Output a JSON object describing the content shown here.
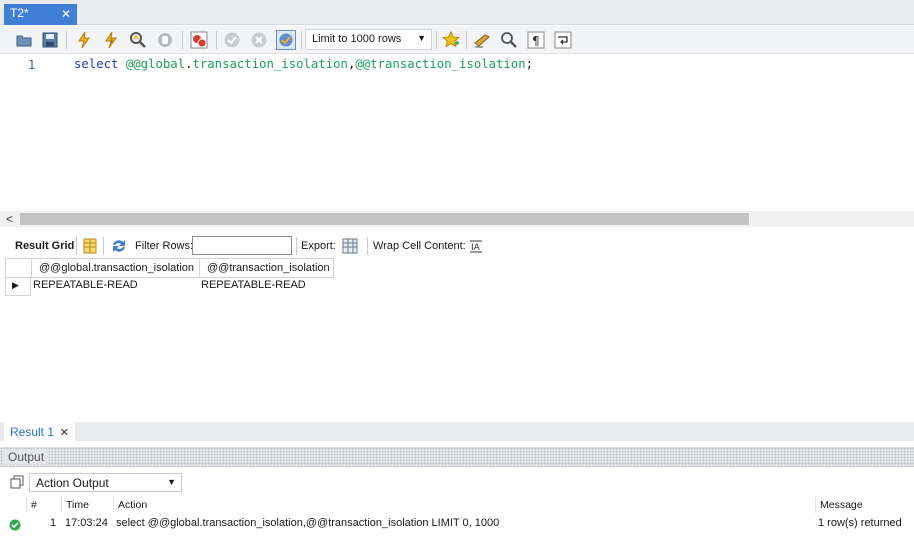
{
  "editor_tab": {
    "title": "T2*",
    "close_glyph": "✕"
  },
  "toolbar": {
    "buttons": [
      {
        "name": "open-file-icon"
      },
      {
        "name": "save-icon"
      },
      {
        "name": "execute-icon"
      },
      {
        "name": "execute-current-icon"
      },
      {
        "name": "explain-icon"
      },
      {
        "name": "stop-icon"
      },
      {
        "name": "toggle-error-stop-icon"
      },
      {
        "name": "commit-icon"
      },
      {
        "name": "rollback-icon"
      },
      {
        "name": "autocommit-icon"
      },
      {
        "name": "bookmark-icon"
      },
      {
        "name": "beautify-icon"
      },
      {
        "name": "find-icon"
      },
      {
        "name": "invisible-chars-icon"
      },
      {
        "name": "wrap-icon"
      }
    ],
    "limit_label": "Limit to 1000 rows"
  },
  "editor": {
    "line_number": "1",
    "tokens": {
      "select": "select",
      "global_prefix": "@@global",
      "dot": ".",
      "tx1": "transaction_isolation",
      "comma": ",",
      "session_prefix": "@@",
      "tx2": "transaction_isolation",
      "semicolon": ";"
    }
  },
  "result_toolbar": {
    "result_grid_label": "Result Grid",
    "filter_rows_label": "Filter Rows:",
    "filter_value": "",
    "export_label": "Export:",
    "wrap_label": "Wrap Cell Content:"
  },
  "grid": {
    "columns": [
      "@@global.transaction_isolation",
      "@@transaction_isolation"
    ],
    "rows": [
      [
        "REPEATABLE-READ",
        "REPEATABLE-READ"
      ]
    ]
  },
  "result_tab": {
    "label": "Result 1",
    "close_glyph": "✕"
  },
  "output": {
    "title": "Output",
    "selector_value": "Action Output",
    "columns": {
      "num": "#",
      "time": "Time",
      "action": "Action",
      "message": "Message"
    },
    "rows": [
      {
        "num": "1",
        "time": "17:03:24",
        "action": "select @@global.transaction_isolation,@@transaction_isolation LIMIT 0, 1000",
        "message": "1 row(s) returned"
      }
    ]
  },
  "colors": {
    "tab_active": "#3f7fd6",
    "keyword": "#1f3fb8",
    "variable": "#1fa05a",
    "success": "#2fa84f"
  }
}
